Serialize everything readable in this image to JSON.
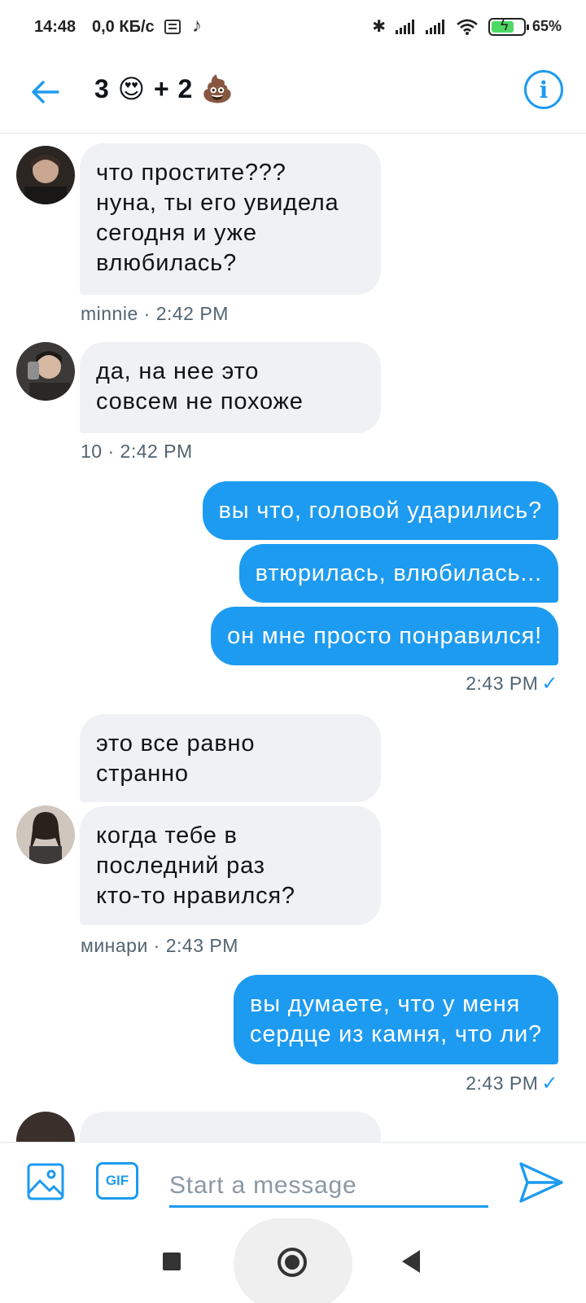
{
  "status_bar": {
    "time": "14:48",
    "net_speed": "0,0 КБ/с",
    "battery_percent": "65%",
    "battery_level": 0.65,
    "icons": [
      "notes-icon",
      "tiktok-icon",
      "bluetooth-icon",
      "signal-icon",
      "signal-icon",
      "wifi-icon",
      "battery-charging-icon"
    ]
  },
  "header": {
    "title": "3 😍 + 2 💩",
    "back_icon": "arrow-left-icon",
    "info_icon": "info-icon"
  },
  "messages": [
    {
      "dir": "in",
      "lines": [
        "что простите???",
        "нуна, ты его увидела",
        "сегодня и уже",
        "влюбилась?"
      ],
      "meta": "minnie · 2:42 PM",
      "avatar": "avatar-minnie"
    },
    {
      "dir": "in",
      "lines": [
        "да, на нее это",
        "совсем не похоже"
      ],
      "meta": "10 · 2:42 PM",
      "avatar": "avatar-10"
    },
    {
      "dir": "out",
      "text": "вы что, головой ударились?"
    },
    {
      "dir": "out",
      "text": "втюрилась, влюбилась..."
    },
    {
      "dir": "out",
      "text": "он мне просто понравился!",
      "meta": "2:43 PM"
    },
    {
      "dir": "in",
      "lines": [
        "это все равно",
        "странно"
      ]
    },
    {
      "dir": "in",
      "lines": [
        "когда тебе в",
        "последний раз",
        "кто-то нравился?"
      ],
      "meta": "минари · 2:43 PM",
      "avatar": "avatar-minari"
    },
    {
      "dir": "out",
      "lines": [
        "вы думаете, что у меня",
        "сердце из камня, что ли?"
      ],
      "meta": "2:43 PM"
    }
  ],
  "composer": {
    "placeholder": "Start a message",
    "gif_label": "GIF",
    "image_icon": "image-icon",
    "send_icon": "send-icon"
  },
  "colors": {
    "accent": "#1d9bf0",
    "bubble_in": "#eff1f4",
    "meta_text": "#536471"
  }
}
